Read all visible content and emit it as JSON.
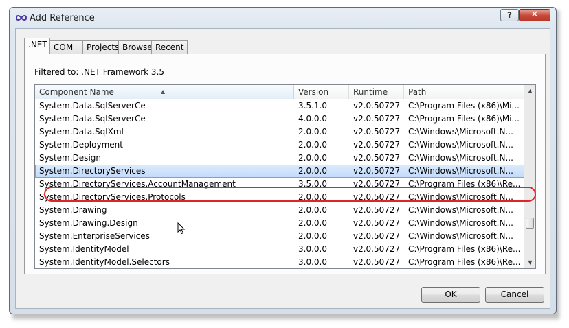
{
  "window": {
    "title": "Add Reference",
    "help_label": "?",
    "close_label": "✕"
  },
  "tabs": [
    {
      "label": ".NET",
      "active": true
    },
    {
      "label": "COM",
      "active": false
    },
    {
      "label": "Projects",
      "active": false
    },
    {
      "label": "Browse",
      "active": false
    },
    {
      "label": "Recent",
      "active": false
    }
  ],
  "filter_text": "Filtered to: .NET Framework 3.5",
  "table": {
    "columns": [
      "Component Name",
      "Version",
      "Runtime",
      "Path"
    ],
    "sorted_column": "Component Name",
    "rows": [
      [
        "System.Data.SqlServerCe",
        "3.5.1.0",
        "v2.0.50727",
        "C:\\Program Files (x86)\\Mi..."
      ],
      [
        "System.Data.SqlServerCe",
        "4.0.0.0",
        "v2.0.50727",
        "C:\\Program Files (x86)\\Mi..."
      ],
      [
        "System.Data.SqlXml",
        "2.0.0.0",
        "v2.0.50727",
        "C:\\Windows\\Microsoft.N..."
      ],
      [
        "System.Deployment",
        "2.0.0.0",
        "v2.0.50727",
        "C:\\Windows\\Microsoft.N..."
      ],
      [
        "System.Design",
        "2.0.0.0",
        "v2.0.50727",
        "C:\\Windows\\Microsoft.N..."
      ],
      [
        "System.DirectoryServices",
        "2.0.0.0",
        "v2.0.50727",
        "C:\\Windows\\Microsoft.N..."
      ],
      [
        "System.DirectoryServices.AccountManagement",
        "3.5.0.0",
        "v2.0.50727",
        "C:\\Program Files (x86)\\Re..."
      ],
      [
        "System.DirectoryServices.Protocols",
        "2.0.0.0",
        "v2.0.50727",
        "C:\\Windows\\Microsoft.N..."
      ],
      [
        "System.Drawing",
        "2.0.0.0",
        "v2.0.50727",
        "C:\\Windows\\Microsoft.N..."
      ],
      [
        "System.Drawing.Design",
        "2.0.0.0",
        "v2.0.50727",
        "C:\\Windows\\Microsoft.N..."
      ],
      [
        "System.EnterpriseServices",
        "2.0.0.0",
        "v2.0.50727",
        "C:\\Windows\\Microsoft.N..."
      ],
      [
        "System.IdentityModel",
        "3.0.0.0",
        "v2.0.50727",
        "C:\\Program Files (x86)\\Re..."
      ],
      [
        "System.IdentityModel.Selectors",
        "3.0.0.0",
        "v2.0.50727",
        "C:\\Program Files (x86)\\Re..."
      ]
    ],
    "selected_row": 5,
    "highlight_color": "#e0252a",
    "selection_color": "#c1dbfc"
  },
  "buttons": {
    "ok": "OK",
    "cancel": "Cancel"
  }
}
